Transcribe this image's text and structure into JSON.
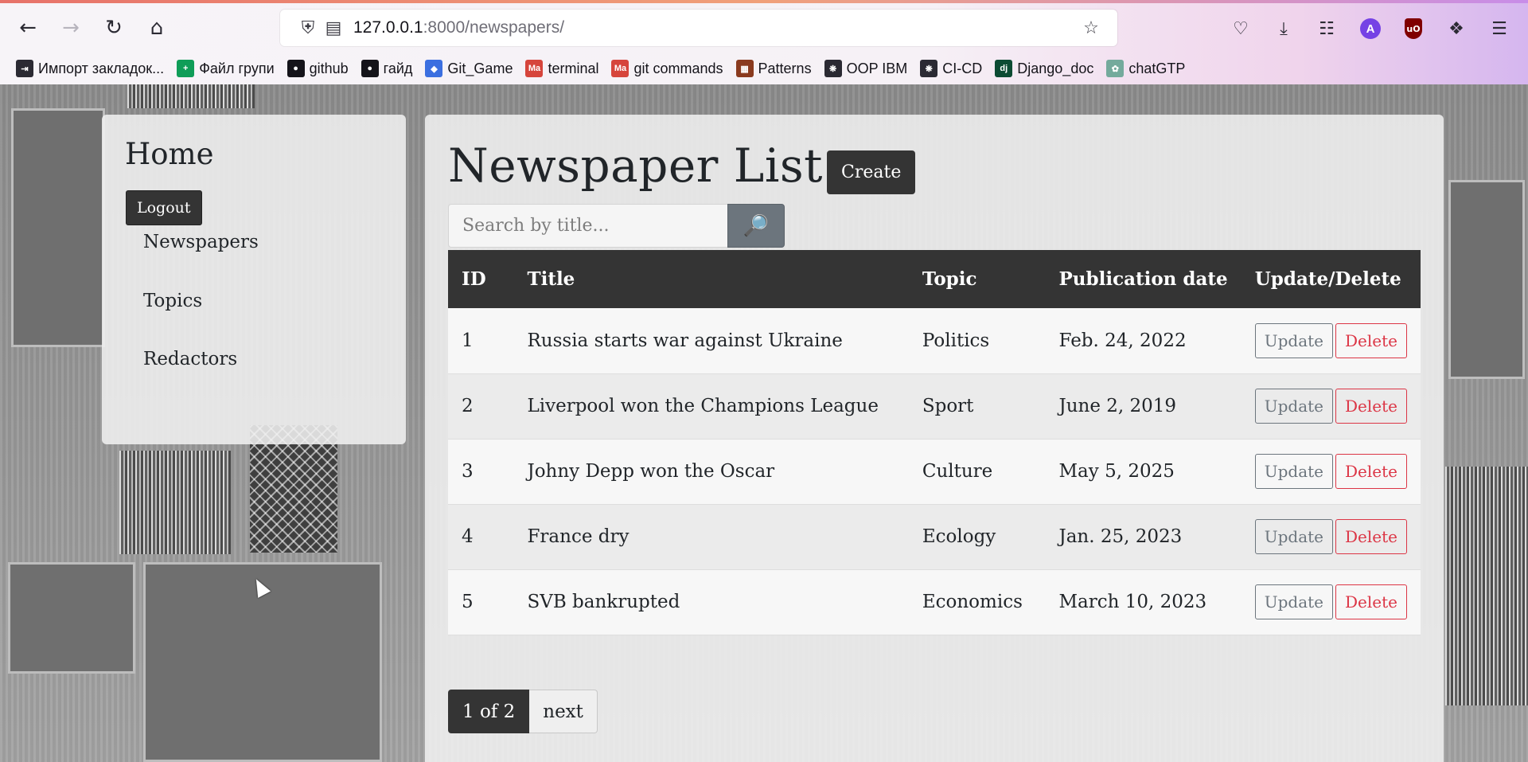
{
  "browser": {
    "url_host": "127.0.0.1",
    "url_path": ":8000/newspapers/",
    "avatar_letter": "A",
    "bookmarks": [
      {
        "label": "Импорт закладок...",
        "icon": "import-icon",
        "color": "#2b2a33"
      },
      {
        "label": "Файл групи",
        "icon": "sheets-icon",
        "color": "#0f9d58"
      },
      {
        "label": "github",
        "icon": "github-icon",
        "color": "#15141a"
      },
      {
        "label": "гайд",
        "icon": "github-icon",
        "color": "#15141a"
      },
      {
        "label": "Git_Game",
        "icon": "game-icon",
        "color": "#3b6fe0"
      },
      {
        "label": "terminal",
        "icon": "terminal-icon",
        "color": "#d6453c"
      },
      {
        "label": "git commands",
        "icon": "terminal-icon",
        "color": "#d6453c"
      },
      {
        "label": "Patterns",
        "icon": "patterns-icon",
        "color": "#8a3a1e"
      },
      {
        "label": "OOP IBM",
        "icon": "bee-icon",
        "color": "#2b2a33"
      },
      {
        "label": "CI-CD",
        "icon": "bee-icon",
        "color": "#2b2a33"
      },
      {
        "label": "Django_doc",
        "icon": "django-icon",
        "color": "#0c4b33"
      },
      {
        "label": "chatGTP",
        "icon": "openai-icon",
        "color": "#74aa9c"
      }
    ]
  },
  "sidebar": {
    "brand": "Home",
    "logout_label": "Logout",
    "links": [
      "Newspapers",
      "Topics",
      "Redactors"
    ]
  },
  "main": {
    "heading": "Newspaper List",
    "create_label": "Create",
    "search_placeholder": "Search by title...",
    "search_icon": "magnifier-icon",
    "columns": [
      "ID",
      "Title",
      "Topic",
      "Publication date",
      "Update/Delete"
    ],
    "rows": [
      {
        "id": "1",
        "title": "Russia starts war against Ukraine",
        "topic": "Politics",
        "date": "Feb. 24, 2022"
      },
      {
        "id": "2",
        "title": "Liverpool won the Champions League",
        "topic": "Sport",
        "date": "June 2, 2019"
      },
      {
        "id": "3",
        "title": "Johny Depp won the Oscar",
        "topic": "Culture",
        "date": "May 5, 2025"
      },
      {
        "id": "4",
        "title": "France dry",
        "topic": "Ecology",
        "date": "Jan. 25, 2023"
      },
      {
        "id": "5",
        "title": "SVB bankrupted",
        "topic": "Economics",
        "date": "March 10, 2023"
      }
    ],
    "update_label": "Update",
    "delete_label": "Delete",
    "pager": {
      "current": "1 of 2",
      "next": "next"
    }
  }
}
